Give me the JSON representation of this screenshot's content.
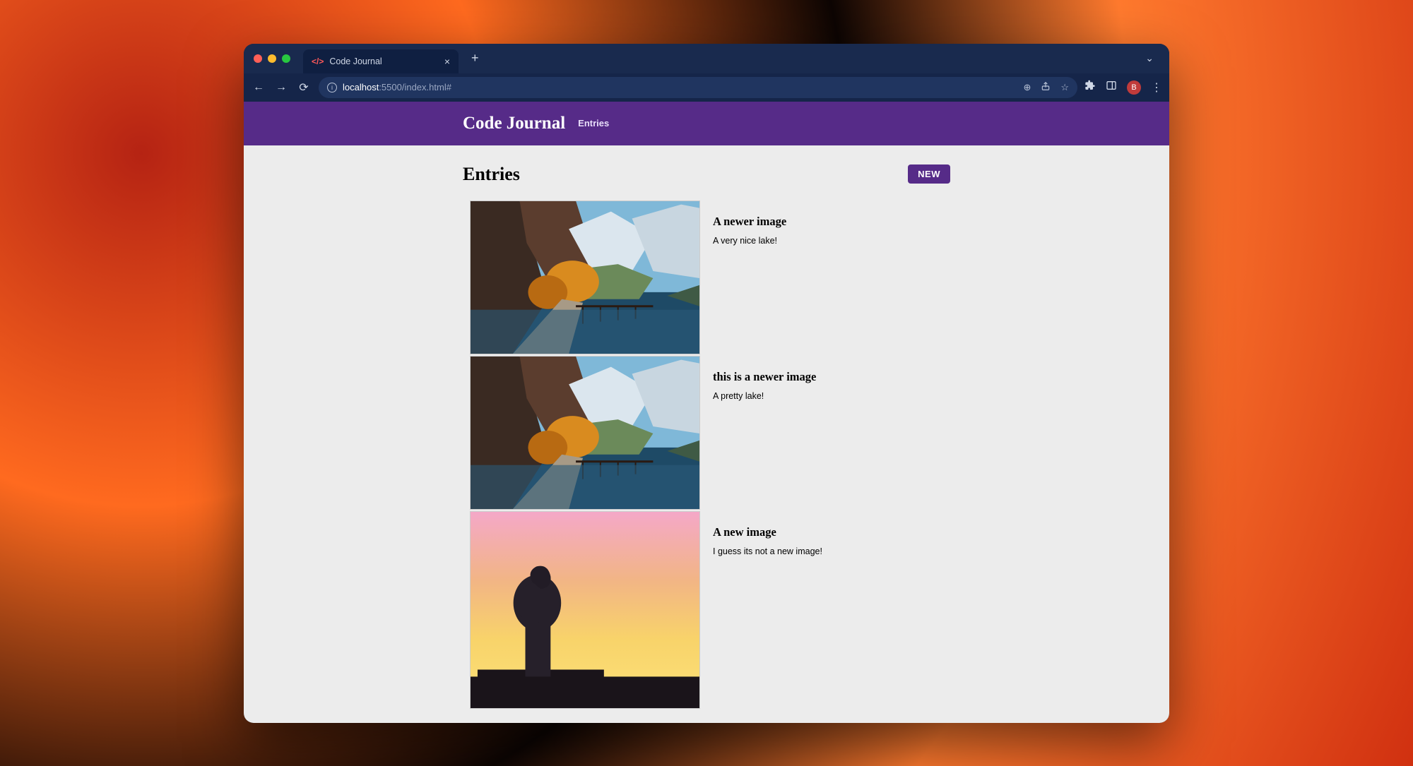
{
  "browser": {
    "tab_title": "Code Journal",
    "url_host": "localhost",
    "url_rest": ":5500/index.html#",
    "avatar_initial": "B"
  },
  "header": {
    "brand": "Code Journal",
    "nav_entries": "Entries"
  },
  "page": {
    "heading": "Entries",
    "new_button": "NEW"
  },
  "entries": [
    {
      "title": "A newer image",
      "description": "A very nice lake!",
      "image": "lake"
    },
    {
      "title": "this is a newer image",
      "description": "A pretty lake!",
      "image": "lake"
    },
    {
      "title": "A new image",
      "description": "I guess its not a new image!",
      "image": "sunset"
    }
  ]
}
